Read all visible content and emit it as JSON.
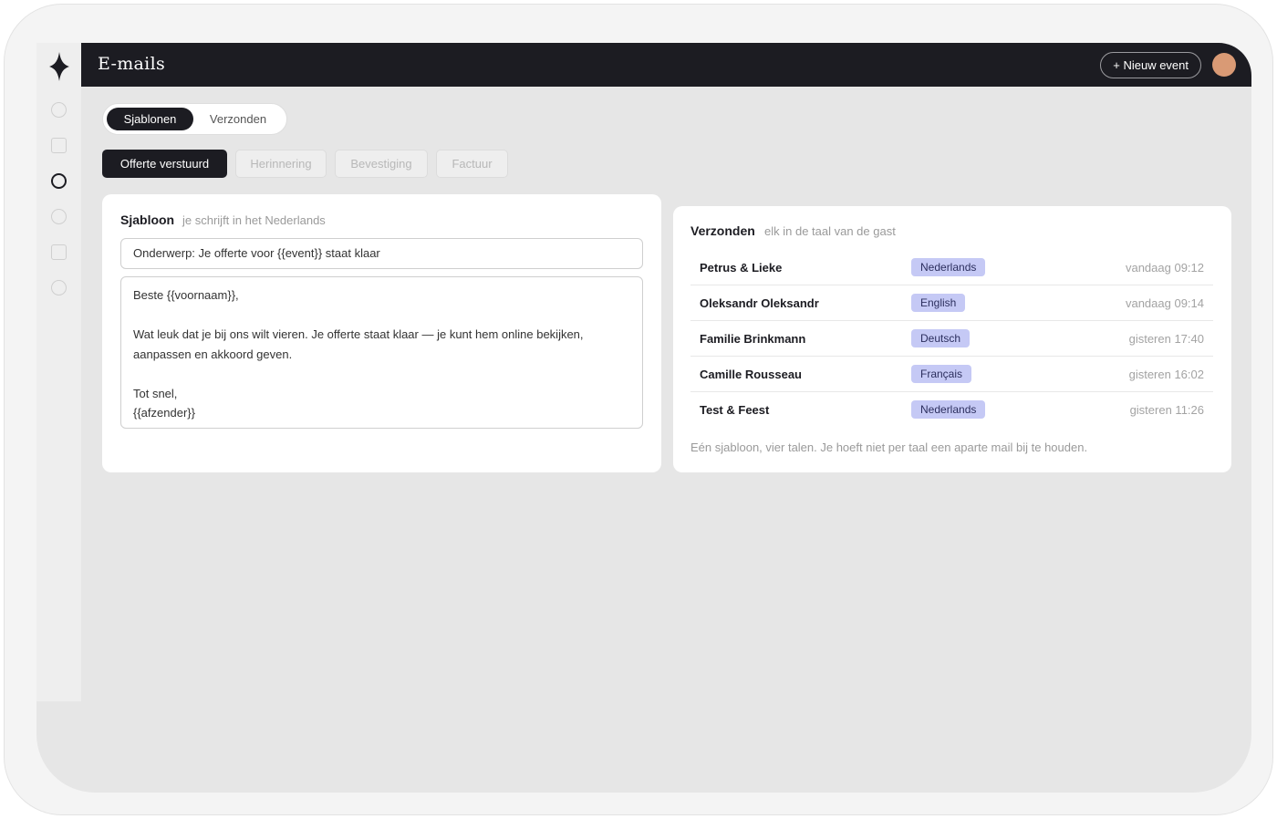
{
  "topbar": {
    "title": "E-mails",
    "new_event_label": "+ Nieuw event"
  },
  "tabs": {
    "templates": "Sjablonen",
    "sent": "Verzonden"
  },
  "template_chips": [
    "Offerte verstuurd",
    "Herinnering",
    "Bevestiging",
    "Factuur"
  ],
  "template_card": {
    "title": "Sjabloon",
    "subtitle": "je schrijft in het Nederlands",
    "subject": "Onderwerp: Je offerte voor {{event}} staat klaar",
    "body": {
      "greeting": "Beste {{voornaam}},",
      "paragraph_1": "Wat leuk dat je bij ons wilt vieren. Je offerte staat klaar — je kunt hem online bekijken,",
      "paragraph_2": "aanpassen en akkoord geven.",
      "closing": "Tot snel,",
      "signature": "{{afzender}}"
    }
  },
  "sent_card": {
    "title": "Verzonden",
    "subtitle": "elk in de taal van de gast",
    "rows": [
      {
        "name": "Petrus & Lieke",
        "language": "Nederlands",
        "time": "vandaag 09:12"
      },
      {
        "name": "Oleksandr Oleksandr",
        "language": "English",
        "time": "vandaag 09:14"
      },
      {
        "name": "Familie Brinkmann",
        "language": "Deutsch",
        "time": "gisteren 17:40"
      },
      {
        "name": "Camille Rousseau",
        "language": "Français",
        "time": "gisteren 16:02"
      },
      {
        "name": "Test & Feest",
        "language": "Nederlands",
        "time": "gisteren 11:26"
      }
    ],
    "footnote": "Eén sjabloon, vier talen. Je hoeft niet per taal een aparte mail bij te houden."
  },
  "colors": {
    "dark": "#1c1c22",
    "language_badge": "#c5c9f5",
    "avatar": "#d99a75",
    "background": "#e6e6e6"
  }
}
